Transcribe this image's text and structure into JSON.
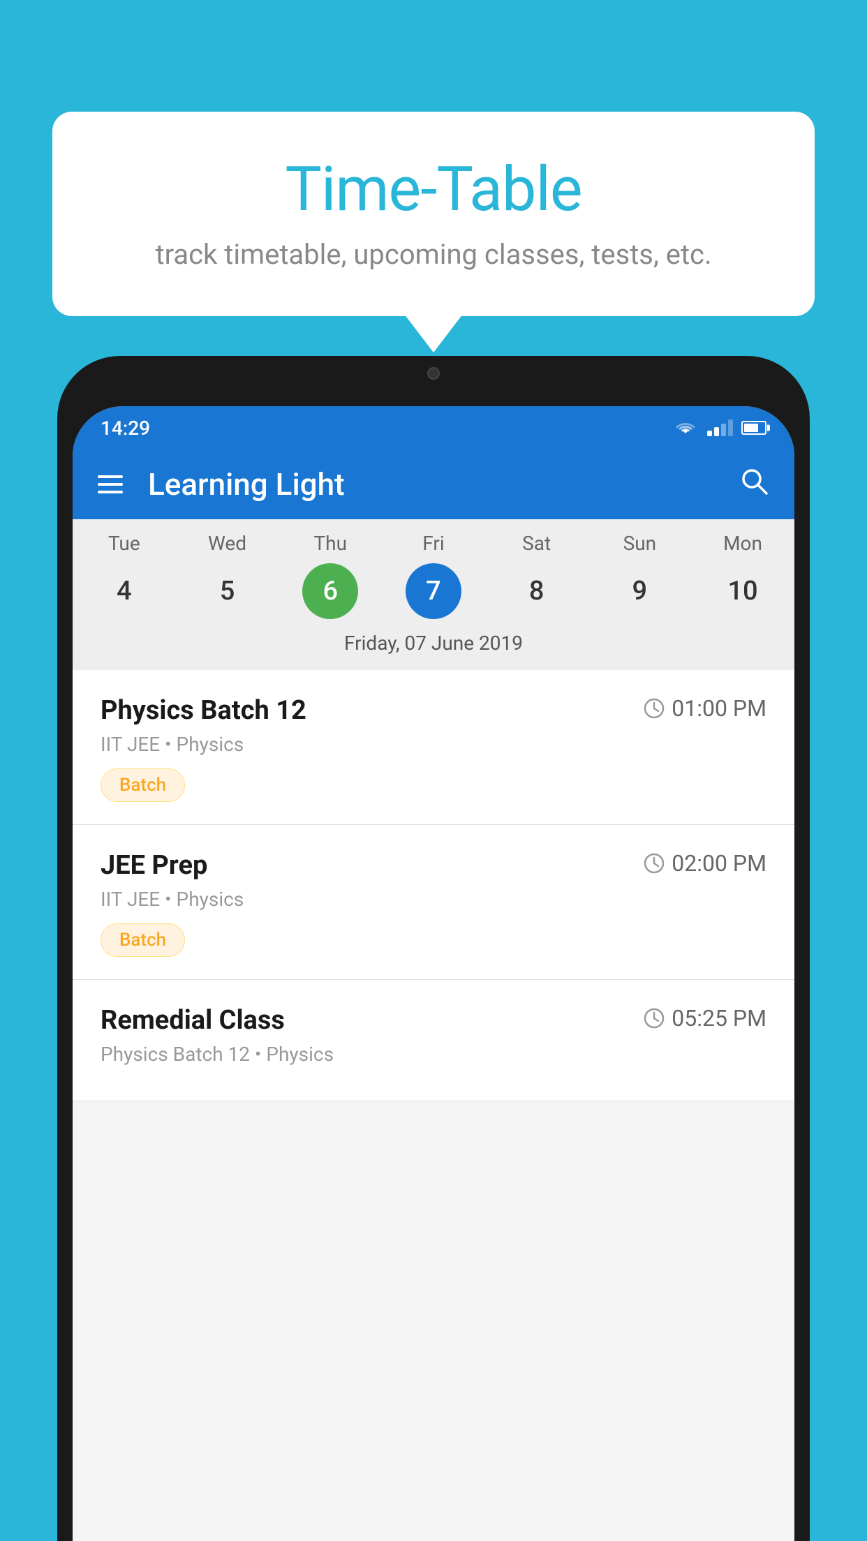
{
  "background_color": "#29B6D8",
  "speech_bubble": {
    "title": "Time-Table",
    "subtitle": "track timetable, upcoming classes, tests, etc."
  },
  "status_bar": {
    "time": "14:29"
  },
  "app_bar": {
    "title": "Learning Light"
  },
  "calendar": {
    "days": [
      {
        "name": "Tue",
        "number": "4"
      },
      {
        "name": "Wed",
        "number": "5"
      },
      {
        "name": "Thu",
        "number": "6",
        "state": "today"
      },
      {
        "name": "Fri",
        "number": "7",
        "state": "selected"
      },
      {
        "name": "Sat",
        "number": "8"
      },
      {
        "name": "Sun",
        "number": "9"
      },
      {
        "name": "Mon",
        "number": "10"
      }
    ],
    "selected_date": "Friday, 07 June 2019"
  },
  "schedule": [
    {
      "class_name": "Physics Batch 12",
      "time": "01:00 PM",
      "meta": "IIT JEE • Physics",
      "tag": "Batch"
    },
    {
      "class_name": "JEE Prep",
      "time": "02:00 PM",
      "meta": "IIT JEE • Physics",
      "tag": "Batch"
    },
    {
      "class_name": "Remedial Class",
      "time": "05:25 PM",
      "meta": "Physics Batch 12 • Physics",
      "tag": ""
    }
  ]
}
